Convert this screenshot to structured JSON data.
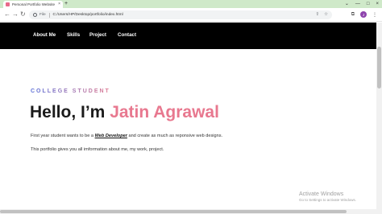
{
  "browser": {
    "tab_title": "Personal Portfolio Website",
    "tab_close": "×",
    "new_tab": "+",
    "window_controls": [
      "⌄",
      "—",
      "□",
      "×"
    ],
    "nav": {
      "back": "←",
      "forward": "→",
      "reload": "↻"
    },
    "address": {
      "scheme_label": "File",
      "url": "C:/Users/HP/Desktop/portfolio/index.html"
    },
    "profile_initial": "J"
  },
  "site": {
    "nav": [
      "About Me",
      "Skills",
      "Project",
      "Contact"
    ],
    "eyebrow": "COLLEGE STUDENT",
    "greeting": "Hello, I’m ",
    "name": "Jatin Agrawal",
    "para1": {
      "before": "First year student wants to be a ",
      "highlight": "Web Developer",
      "after": " and create as much as reponsive web designs."
    },
    "para2": "This portfolio gives you all imformation about me, my work, project."
  },
  "windows_watermark": {
    "line1": "Activate Windows",
    "line2": "Go to Settings to activate Windows."
  },
  "colors": {
    "accent_name": "#e8788f",
    "nav_bg": "#000000",
    "tabstrip_bg": "#cfe9c9"
  }
}
